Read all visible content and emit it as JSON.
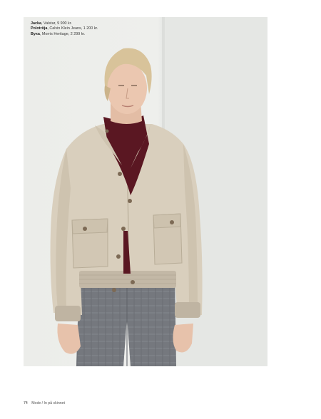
{
  "credits": [
    {
      "item": "Jacka",
      "detail": ", Valstar, 9 900 kr."
    },
    {
      "item": "Polotröja",
      "detail": ", Calvin Klein Jeans, 1 200 kr."
    },
    {
      "item": "Byxa",
      "detail": ", Morris Heritage, 2 299 kr."
    }
  ],
  "footer": {
    "page_number": "74",
    "section": "Mode / In på skinnet"
  },
  "colors": {
    "background": "#ecedea",
    "jacket": "#d9cfbd",
    "turtleneck": "#5a1722",
    "trousers": "#777a80",
    "hair": "#d8c39a"
  }
}
